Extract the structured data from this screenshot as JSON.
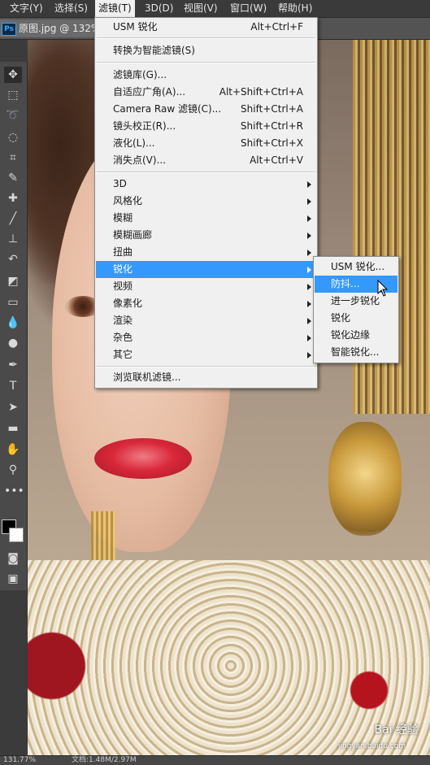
{
  "menubar": {
    "items": [
      {
        "label": "文字(Y)"
      },
      {
        "label": "选择(S)"
      },
      {
        "label": "滤镜(T)"
      },
      {
        "label": "3D(D)"
      },
      {
        "label": "视图(V)"
      },
      {
        "label": "窗口(W)"
      },
      {
        "label": "帮助(H)"
      }
    ],
    "active": "滤镜(T)"
  },
  "document": {
    "app_badge": "Ps",
    "tab_title": "原图.jpg @ 132%"
  },
  "toolbar": {
    "tools": [
      "move-icon",
      "marquee-icon",
      "lasso-icon",
      "quick-select-icon",
      "crop-icon",
      "eyedropper-icon",
      "healing-icon",
      "brush-icon",
      "stamp-icon",
      "history-brush-icon",
      "eraser-icon",
      "gradient-icon",
      "blur-icon",
      "dodge-icon",
      "pen-icon",
      "type-icon",
      "path-select-icon",
      "rectangle-icon",
      "hand-icon",
      "zoom-icon",
      "more-icon"
    ],
    "selected": "move-icon",
    "foreground_color": "#000000",
    "background_color": "#ffffff"
  },
  "filter_menu": {
    "items": [
      {
        "label": "USM 锐化",
        "shortcut": "Alt+Ctrl+F"
      },
      {
        "label": "转换为智能滤镜(S)",
        "shortcut": ""
      },
      {
        "label": "滤镜库(G)...",
        "shortcut": ""
      },
      {
        "label": "自适应广角(A)...",
        "shortcut": "Alt+Shift+Ctrl+A"
      },
      {
        "label": "Camera Raw 滤镜(C)...",
        "shortcut": "Shift+Ctrl+A"
      },
      {
        "label": "镜头校正(R)...",
        "shortcut": "Shift+Ctrl+R"
      },
      {
        "label": "液化(L)...",
        "shortcut": "Shift+Ctrl+X"
      },
      {
        "label": "消失点(V)...",
        "shortcut": "Alt+Ctrl+V"
      },
      {
        "label": "3D",
        "submenu": true
      },
      {
        "label": "风格化",
        "submenu": true
      },
      {
        "label": "模糊",
        "submenu": true
      },
      {
        "label": "模糊画廊",
        "submenu": true
      },
      {
        "label": "扭曲",
        "submenu": true
      },
      {
        "label": "锐化",
        "submenu": true
      },
      {
        "label": "视频",
        "submenu": true
      },
      {
        "label": "像素化",
        "submenu": true
      },
      {
        "label": "渲染",
        "submenu": true
      },
      {
        "label": "杂色",
        "submenu": true
      },
      {
        "label": "其它",
        "submenu": true
      },
      {
        "label": "浏览联机滤镜...",
        "shortcut": ""
      }
    ],
    "highlighted": "锐化",
    "highlight_color": "#3399ff"
  },
  "sharpen_submenu": {
    "items": [
      "USM 锐化...",
      "防抖...",
      "进一步锐化",
      "锐化",
      "锐化边缘",
      "智能锐化..."
    ],
    "highlighted": "防抖..."
  },
  "statusbar": {
    "zoom": "131.77%",
    "doc_info": "文档:1.48M/2.97M"
  },
  "watermark": {
    "brand": "Bai 经验",
    "url": "jingyan.baidu.com"
  }
}
